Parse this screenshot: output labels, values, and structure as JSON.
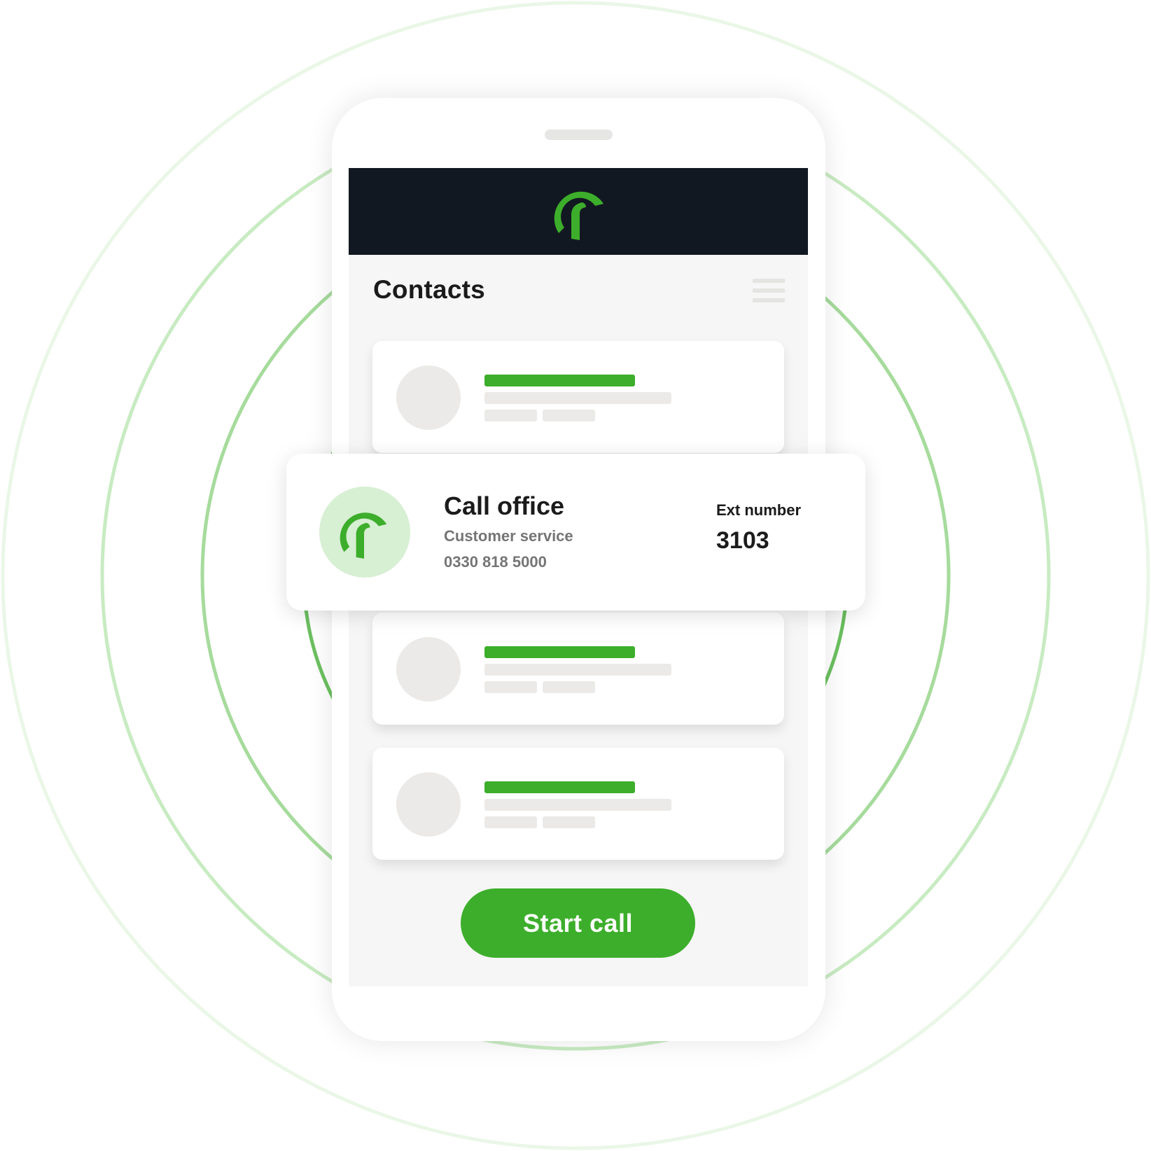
{
  "colors": {
    "brand_green": "#3dae2b",
    "header_dark": "#121821",
    "avatar_tint": "#d7efd3",
    "ring_colors": [
      "#eaf7e7",
      "#c8ebc2",
      "#a6db9c",
      "#6cc060"
    ]
  },
  "header": {
    "logo_icon": "brand-logo-icon"
  },
  "contacts": {
    "title": "Contacts",
    "menu_icon": "hamburger-menu-icon",
    "placeholder_cards": 3
  },
  "featured_contact": {
    "name": "Call office",
    "department": "Customer service",
    "phone": "0330 818 5000",
    "ext_label": "Ext number",
    "ext_value": "3103"
  },
  "actions": {
    "start_call_label": "Start call"
  }
}
